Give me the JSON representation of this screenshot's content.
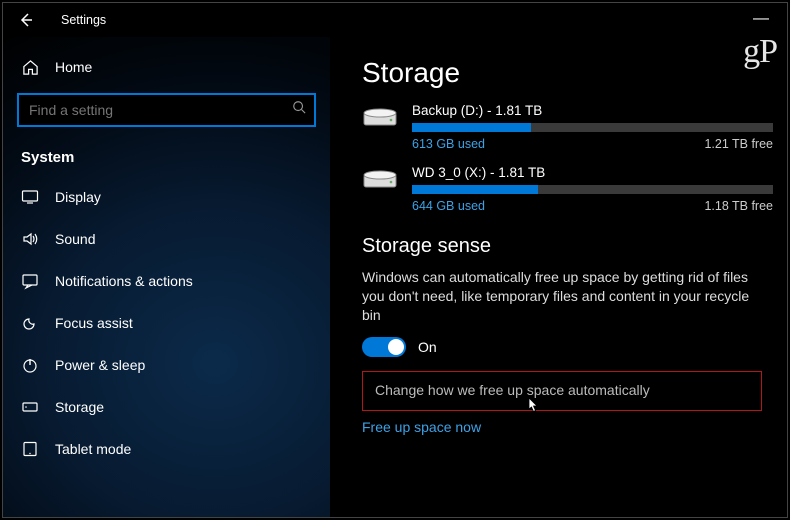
{
  "window": {
    "title": "Settings",
    "minimize_glyph": "—"
  },
  "sidebar": {
    "home_label": "Home",
    "search_placeholder": "Find a setting",
    "category": "System",
    "items": [
      {
        "icon": "display-icon",
        "label": "Display"
      },
      {
        "icon": "sound-icon",
        "label": "Sound"
      },
      {
        "icon": "notifications-icon",
        "label": "Notifications & actions"
      },
      {
        "icon": "focus-assist-icon",
        "label": "Focus assist"
      },
      {
        "icon": "power-sleep-icon",
        "label": "Power & sleep"
      },
      {
        "icon": "storage-icon",
        "label": "Storage"
      },
      {
        "icon": "tablet-mode-icon",
        "label": "Tablet mode"
      }
    ]
  },
  "main": {
    "watermark": "gP",
    "title": "Storage",
    "drives": [
      {
        "name": "Backup (D:) - 1.81 TB",
        "used_label": "613 GB used",
        "free_label": "1.21 TB free",
        "fill_pct": 33
      },
      {
        "name": "WD 3_0 (X:) - 1.81 TB",
        "used_label": "644 GB used",
        "free_label": "1.18 TB free",
        "fill_pct": 35
      }
    ],
    "sense": {
      "heading": "Storage sense",
      "description": "Windows can automatically free up space by getting rid of files you don't need, like temporary files and content in your recycle bin",
      "toggle_state": "On",
      "change_link": "Change how we free up space automatically",
      "free_now_link": "Free up space now"
    }
  }
}
